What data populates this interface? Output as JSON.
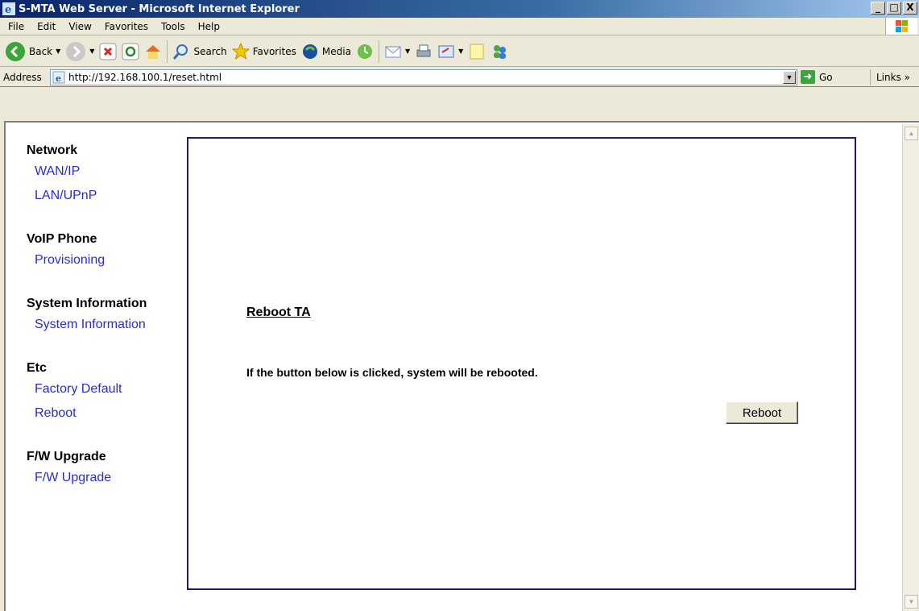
{
  "window": {
    "title": "S-MTA Web Server - Microsoft Internet Explorer",
    "minimize": "_",
    "maximize": "□",
    "close": "X"
  },
  "menu": [
    "File",
    "Edit",
    "View",
    "Favorites",
    "Tools",
    "Help"
  ],
  "toolbar": {
    "back_label": "Back",
    "search_label": "Search",
    "favorites_label": "Favorites",
    "media_label": "Media"
  },
  "address": {
    "label": "Address",
    "url": "http://192.168.100.1/reset.html",
    "go_label": "Go",
    "links_label": "Links »"
  },
  "nav": {
    "groups": [
      {
        "heading": "Network",
        "links": [
          "WAN/IP",
          "LAN/UPnP"
        ]
      },
      {
        "heading": "VoIP Phone",
        "links": [
          "Provisioning"
        ]
      },
      {
        "heading": "System Information",
        "links": [
          "System Information"
        ]
      },
      {
        "heading": "Etc",
        "links": [
          "Factory Default",
          "Reboot"
        ]
      },
      {
        "heading": "F/W Upgrade",
        "links": [
          "F/W Upgrade"
        ]
      }
    ]
  },
  "content": {
    "title": "Reboot TA",
    "message": "If the button below is clicked, system will be rebooted.",
    "button_label": "Reboot"
  },
  "colors": {
    "link": "#2b2bd0",
    "box_border": "#1a1a6e"
  }
}
